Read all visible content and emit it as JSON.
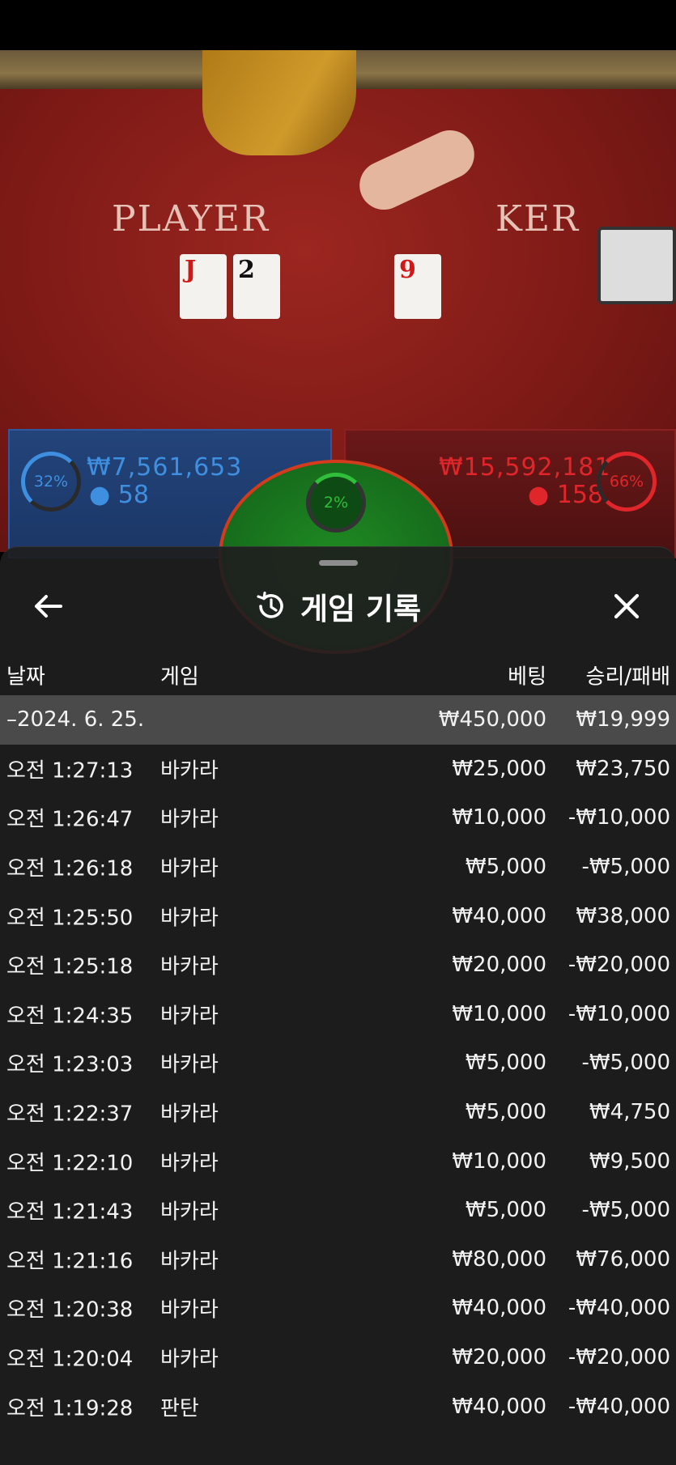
{
  "scene": {
    "player_label": "PLAYER",
    "banker_label": "KER",
    "player_cards": [
      "J",
      "2"
    ],
    "banker_cards": [
      "9"
    ],
    "player_pct": "32%",
    "player_amount": "₩7,561,653",
    "player_count": "58",
    "tie_pct": "2%",
    "banker_pct": "66%",
    "banker_amount": "₩15,592,181",
    "banker_count": "158"
  },
  "sheet": {
    "title": "게임 기록",
    "columns": {
      "date": "날짜",
      "game": "게임",
      "bet": "베팅",
      "result": "승리/패배"
    },
    "summary": {
      "date": "–2024. 6. 25.",
      "bet": "₩450,000",
      "result": "₩19,999"
    },
    "rows": [
      {
        "time": "오전 1:27:13",
        "game": "바카라",
        "bet": "₩25,000",
        "result": "₩23,750"
      },
      {
        "time": "오전 1:26:47",
        "game": "바카라",
        "bet": "₩10,000",
        "result": "-₩10,000"
      },
      {
        "time": "오전 1:26:18",
        "game": "바카라",
        "bet": "₩5,000",
        "result": "-₩5,000"
      },
      {
        "time": "오전 1:25:50",
        "game": "바카라",
        "bet": "₩40,000",
        "result": "₩38,000"
      },
      {
        "time": "오전 1:25:18",
        "game": "바카라",
        "bet": "₩20,000",
        "result": "-₩20,000"
      },
      {
        "time": "오전 1:24:35",
        "game": "바카라",
        "bet": "₩10,000",
        "result": "-₩10,000"
      },
      {
        "time": "오전 1:23:03",
        "game": "바카라",
        "bet": "₩5,000",
        "result": "-₩5,000"
      },
      {
        "time": "오전 1:22:37",
        "game": "바카라",
        "bet": "₩5,000",
        "result": "₩4,750"
      },
      {
        "time": "오전 1:22:10",
        "game": "바카라",
        "bet": "₩10,000",
        "result": "₩9,500"
      },
      {
        "time": "오전 1:21:43",
        "game": "바카라",
        "bet": "₩5,000",
        "result": "-₩5,000"
      },
      {
        "time": "오전 1:21:16",
        "game": "바카라",
        "bet": "₩80,000",
        "result": "₩76,000"
      },
      {
        "time": "오전 1:20:38",
        "game": "바카라",
        "bet": "₩40,000",
        "result": "-₩40,000"
      },
      {
        "time": "오전 1:20:04",
        "game": "바카라",
        "bet": "₩20,000",
        "result": "-₩20,000"
      },
      {
        "time": "오전 1:19:28",
        "game": "판탄",
        "bet": "₩40,000",
        "result": "-₩40,000"
      }
    ]
  },
  "colors": {
    "player_blue": "#3f8fe0",
    "banker_red": "#e0262a",
    "tie_green": "#2fbf3a",
    "summary_row_bg": "#4a4a4a",
    "sheet_bg": "#1e1e1e"
  },
  "icons": {
    "back": "arrow-left-icon",
    "history": "history-icon",
    "close": "close-icon"
  }
}
